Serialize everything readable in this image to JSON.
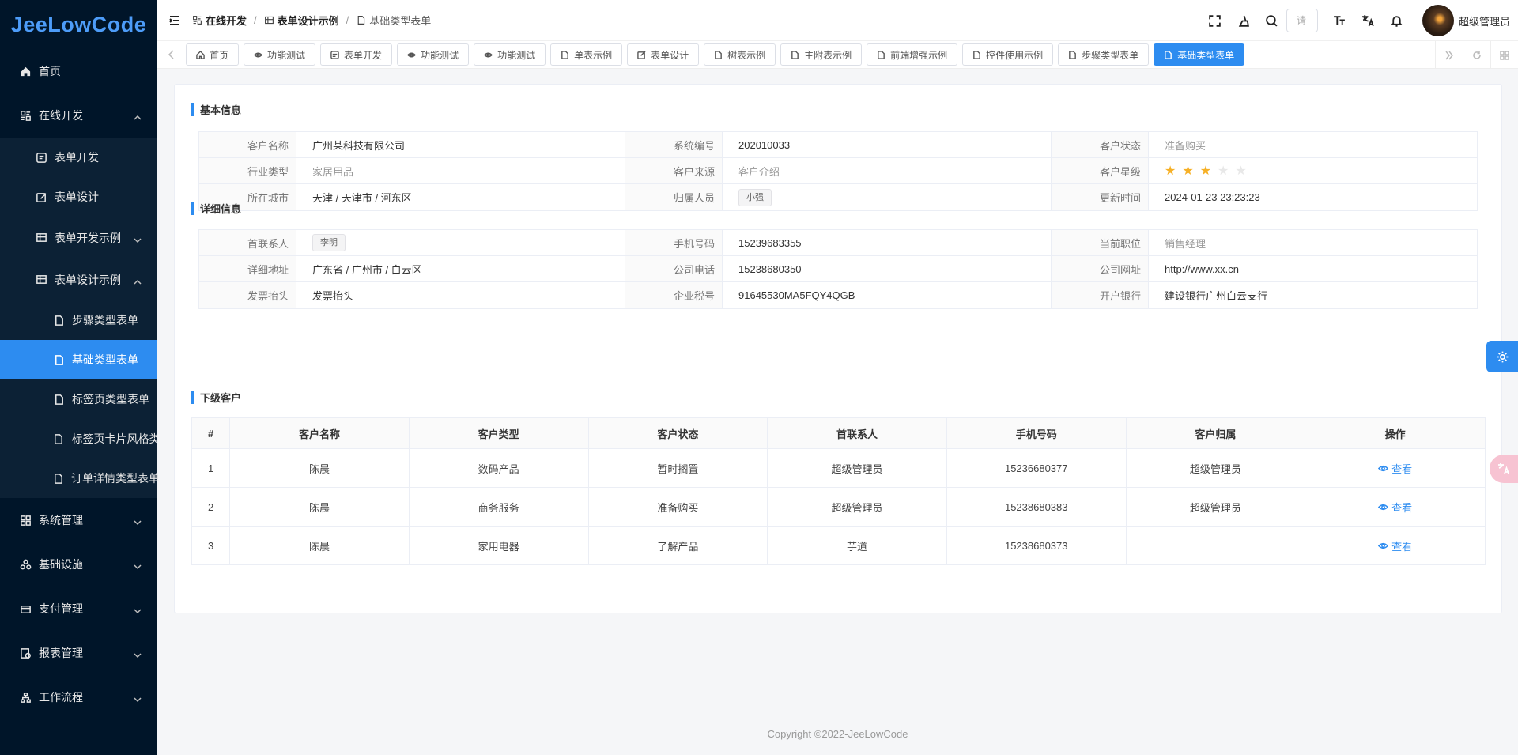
{
  "app": {
    "logo": "JeeLowCode",
    "footer": "Copyright ©2022-JeeLowCode"
  },
  "sidebar": {
    "items": [
      {
        "label": "首页",
        "icon": "home-icon"
      },
      {
        "label": "在线开发",
        "icon": "dev-icon"
      },
      {
        "label": "表单开发",
        "icon": "form-icon"
      },
      {
        "label": "表单设计",
        "icon": "edit-icon"
      },
      {
        "label": "表单开发示例",
        "icon": "table-icon"
      },
      {
        "label": "表单设计示例",
        "icon": "table-icon"
      },
      {
        "label": "步骤类型表单",
        "icon": "doc-icon"
      },
      {
        "label": "基础类型表单",
        "icon": "doc-icon"
      },
      {
        "label": "标签页类型表单",
        "icon": "doc-icon"
      },
      {
        "label": "标签页卡片风格类",
        "icon": "doc-icon"
      },
      {
        "label": "订单详情类型表单",
        "icon": "doc-icon"
      },
      {
        "label": "系统管理",
        "icon": "grid-icon"
      },
      {
        "label": "基础设施",
        "icon": "infra-icon"
      },
      {
        "label": "支付管理",
        "icon": "card-icon"
      },
      {
        "label": "报表管理",
        "icon": "report-icon"
      },
      {
        "label": "工作流程",
        "icon": "flow-icon"
      }
    ]
  },
  "header": {
    "breadcrumb": [
      "在线开发",
      "表单设计示例",
      "基础类型表单"
    ],
    "search_placeholder": "请",
    "username": "超级管理员"
  },
  "tabs": [
    {
      "label": "首页",
      "icon": "home-icon"
    },
    {
      "label": "功能测试",
      "icon": "eye-icon"
    },
    {
      "label": "表单开发",
      "icon": "form-icon"
    },
    {
      "label": "功能测试",
      "icon": "eye-icon"
    },
    {
      "label": "功能测试",
      "icon": "eye-icon"
    },
    {
      "label": "单表示例",
      "icon": "doc-icon"
    },
    {
      "label": "表单设计",
      "icon": "edit-icon"
    },
    {
      "label": "树表示例",
      "icon": "doc-icon"
    },
    {
      "label": "主附表示例",
      "icon": "doc-icon"
    },
    {
      "label": "前端增强示例",
      "icon": "doc-icon"
    },
    {
      "label": "控件使用示例",
      "icon": "doc-icon"
    },
    {
      "label": "步骤类型表单",
      "icon": "doc-icon"
    },
    {
      "label": "基础类型表单",
      "icon": "doc-icon",
      "active": true
    }
  ],
  "basic": {
    "title": "基本信息",
    "l1": "客户名称",
    "v1": "广州某科技有限公司",
    "l2": "系统编号",
    "v2": "202010033",
    "l3": "客户状态",
    "v3": "准备购买",
    "l4": "行业类型",
    "v4": "家居用品",
    "l5": "客户来源",
    "v5": "客户介绍",
    "l6": "客户星级",
    "rating": 3,
    "rating_max": 5,
    "l7": "所在城市",
    "v7": "天津 / 天津市 / 河东区",
    "l8": "归属人员",
    "v8": "小强",
    "l9": "更新时间",
    "v9": "2024-01-23 23:23:23"
  },
  "detail": {
    "title": "详细信息",
    "l1": "首联系人",
    "v1": "李明",
    "l2": "手机号码",
    "v2": "15239683355",
    "l3": "当前职位",
    "v3": "销售经理",
    "l4": "详细地址",
    "v4": "广东省 / 广州市 / 白云区",
    "l5": "公司电话",
    "v5": "15238680350",
    "l6": "公司网址",
    "v6": "http://www.xx.cn",
    "l7": "发票抬头",
    "v7": "发票抬头",
    "l8": "企业税号",
    "v8": "91645530MA5FQY4QGB",
    "l9": "开户银行",
    "v9": "建设银行广州白云支行"
  },
  "sub": {
    "title": "下级客户",
    "columns": [
      "#",
      "客户名称",
      "客户类型",
      "客户状态",
      "首联系人",
      "手机号码",
      "客户归属",
      "操作"
    ],
    "rows": [
      [
        "1",
        "陈晨",
        "数码产品",
        "暂时搁置",
        "超级管理员",
        "15236680377",
        "超级管理员",
        "查看"
      ],
      [
        "2",
        "陈晨",
        "商务服务",
        "准备购买",
        "超级管理员",
        "15238680383",
        "超级管理员",
        "查看"
      ],
      [
        "3",
        "陈晨",
        "家用电器",
        "了解产品",
        "芋道",
        "15238680373",
        "",
        "查看"
      ]
    ]
  }
}
